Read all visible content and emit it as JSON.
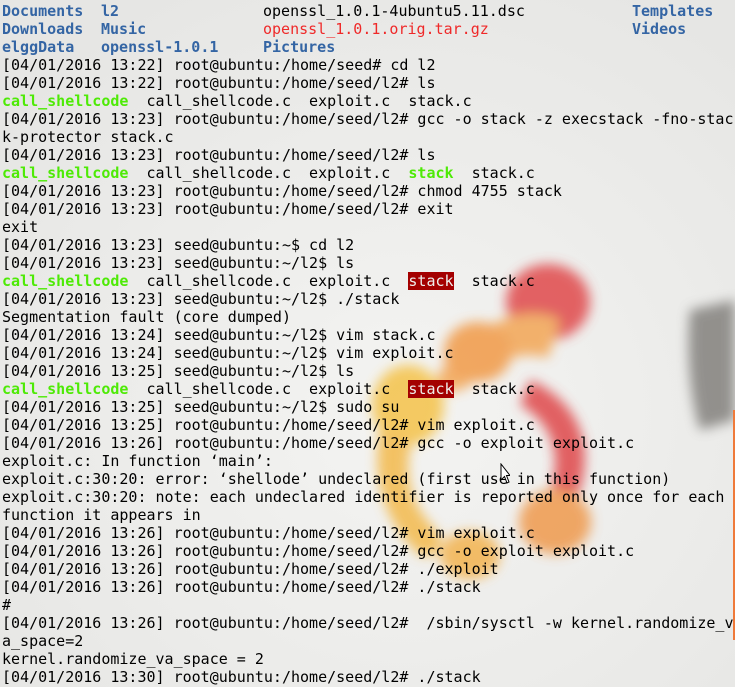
{
  "ls_listing": {
    "rows": [
      [
        "Documents",
        "l2",
        "openssl_1.0.1-4ubuntu5.11.dsc",
        "Templates"
      ],
      [
        "Downloads",
        "Music",
        "openssl_1.0.1.orig.tar.gz",
        "Videos"
      ],
      [
        "elggData",
        "openssl-1.0.1",
        "Pictures",
        ""
      ]
    ]
  },
  "lines": [
    {
      "parts": [
        {
          "t": "[04/01/2016 13:22] root@ubuntu:/home/seed# cd l2"
        }
      ]
    },
    {
      "parts": [
        {
          "t": "[04/01/2016 13:22] root@ubuntu:/home/seed/l2# ls"
        }
      ]
    },
    {
      "parts": [
        {
          "t": "call_shellcode",
          "c": "exec"
        },
        {
          "t": "  call_shellcode.c  exploit.c  stack.c"
        }
      ]
    },
    {
      "parts": [
        {
          "t": "[04/01/2016 13:23] root@ubuntu:/home/seed/l2# gcc -o stack -z execstack -fno-stac"
        }
      ]
    },
    {
      "parts": [
        {
          "t": "k-protector stack.c"
        }
      ]
    },
    {
      "parts": [
        {
          "t": "[04/01/2016 13:23] root@ubuntu:/home/seed/l2# ls"
        }
      ]
    },
    {
      "parts": [
        {
          "t": "call_shellcode",
          "c": "exec"
        },
        {
          "t": "  call_shellcode.c  exploit.c  "
        },
        {
          "t": "stack",
          "c": "exec"
        },
        {
          "t": "  stack.c"
        }
      ]
    },
    {
      "parts": [
        {
          "t": "[04/01/2016 13:23] root@ubuntu:/home/seed/l2# chmod 4755 stack"
        }
      ]
    },
    {
      "parts": [
        {
          "t": "[04/01/2016 13:23] root@ubuntu:/home/seed/l2# exit"
        }
      ]
    },
    {
      "parts": [
        {
          "t": "exit"
        }
      ]
    },
    {
      "parts": [
        {
          "t": "[04/01/2016 13:23] seed@ubuntu:~$ cd l2"
        }
      ]
    },
    {
      "parts": [
        {
          "t": "[04/01/2016 13:23] seed@ubuntu:~/l2$ ls"
        }
      ]
    },
    {
      "parts": [
        {
          "t": "call_shellcode",
          "c": "exec"
        },
        {
          "t": "  call_shellcode.c  exploit.c  "
        },
        {
          "t": "stack",
          "c": "setuid"
        },
        {
          "t": "  stack.c"
        }
      ]
    },
    {
      "parts": [
        {
          "t": "[04/01/2016 13:23] seed@ubuntu:~/l2$ ./stack"
        }
      ]
    },
    {
      "parts": [
        {
          "t": "Segmentation fault (core dumped)"
        }
      ]
    },
    {
      "parts": [
        {
          "t": "[04/01/2016 13:24] seed@ubuntu:~/l2$ vim stack.c"
        }
      ]
    },
    {
      "parts": [
        {
          "t": "[04/01/2016 13:24] seed@ubuntu:~/l2$ vim exploit.c"
        }
      ]
    },
    {
      "parts": [
        {
          "t": "[04/01/2016 13:25] seed@ubuntu:~/l2$ ls"
        }
      ]
    },
    {
      "parts": [
        {
          "t": "call_shellcode",
          "c": "exec"
        },
        {
          "t": "  call_shellcode.c  exploit.c  "
        },
        {
          "t": "stack",
          "c": "setuid"
        },
        {
          "t": "  stack.c"
        }
      ]
    },
    {
      "parts": [
        {
          "t": "[04/01/2016 13:25] seed@ubuntu:~/l2$ sudo su"
        }
      ]
    },
    {
      "parts": [
        {
          "t": "[04/01/2016 13:25] root@ubuntu:/home/seed/l2# vim exploit.c"
        }
      ]
    },
    {
      "parts": [
        {
          "t": "[04/01/2016 13:26] root@ubuntu:/home/seed/l2# gcc -o exploit exploit.c"
        }
      ]
    },
    {
      "parts": [
        {
          "t": "exploit.c: In function ‘main’:"
        }
      ]
    },
    {
      "parts": [
        {
          "t": "exploit.c:30:20: error: ‘shellode’ undeclared (first use in this function)"
        }
      ]
    },
    {
      "parts": [
        {
          "t": "exploit.c:30:20: note: each undeclared identifier is reported only once for each"
        }
      ]
    },
    {
      "parts": [
        {
          "t": "function it appears in"
        }
      ]
    },
    {
      "parts": [
        {
          "t": "[04/01/2016 13:26] root@ubuntu:/home/seed/l2# vim exploit.c"
        }
      ]
    },
    {
      "parts": [
        {
          "t": "[04/01/2016 13:26] root@ubuntu:/home/seed/l2# gcc -o exploit exploit.c"
        }
      ]
    },
    {
      "parts": [
        {
          "t": "[04/01/2016 13:26] root@ubuntu:/home/seed/l2# ./exploit"
        }
      ]
    },
    {
      "parts": [
        {
          "t": "[04/01/2016 13:26] root@ubuntu:/home/seed/l2# ./stack"
        }
      ]
    },
    {
      "parts": [
        {
          "t": "#"
        }
      ]
    },
    {
      "parts": [
        {
          "t": "[04/01/2016 13:26] root@ubuntu:/home/seed/l2#  /sbin/sysctl -w kernel.randomize_v"
        }
      ]
    },
    {
      "parts": [
        {
          "t": "a_space=2"
        }
      ]
    },
    {
      "parts": [
        {
          "t": "kernel.randomize_va_space = 2"
        }
      ]
    },
    {
      "parts": [
        {
          "t": "[04/01/2016 13:30] root@ubuntu:/home/seed/l2# ./stack"
        }
      ]
    }
  ],
  "colors": {
    "background": "#eeeeec",
    "text": "#000000",
    "directory": "#3465a4",
    "archive": "#ef2929",
    "executable": "#4eea06",
    "setuid_bg": "#a40000",
    "logo_orange": "#f5a04a",
    "logo_red": "#e0484a",
    "logo_yellow": "#f6c94c"
  },
  "icons": {
    "wallpaper": "ubuntu-logo-icon",
    "pointer": "mouse-cursor-icon"
  }
}
